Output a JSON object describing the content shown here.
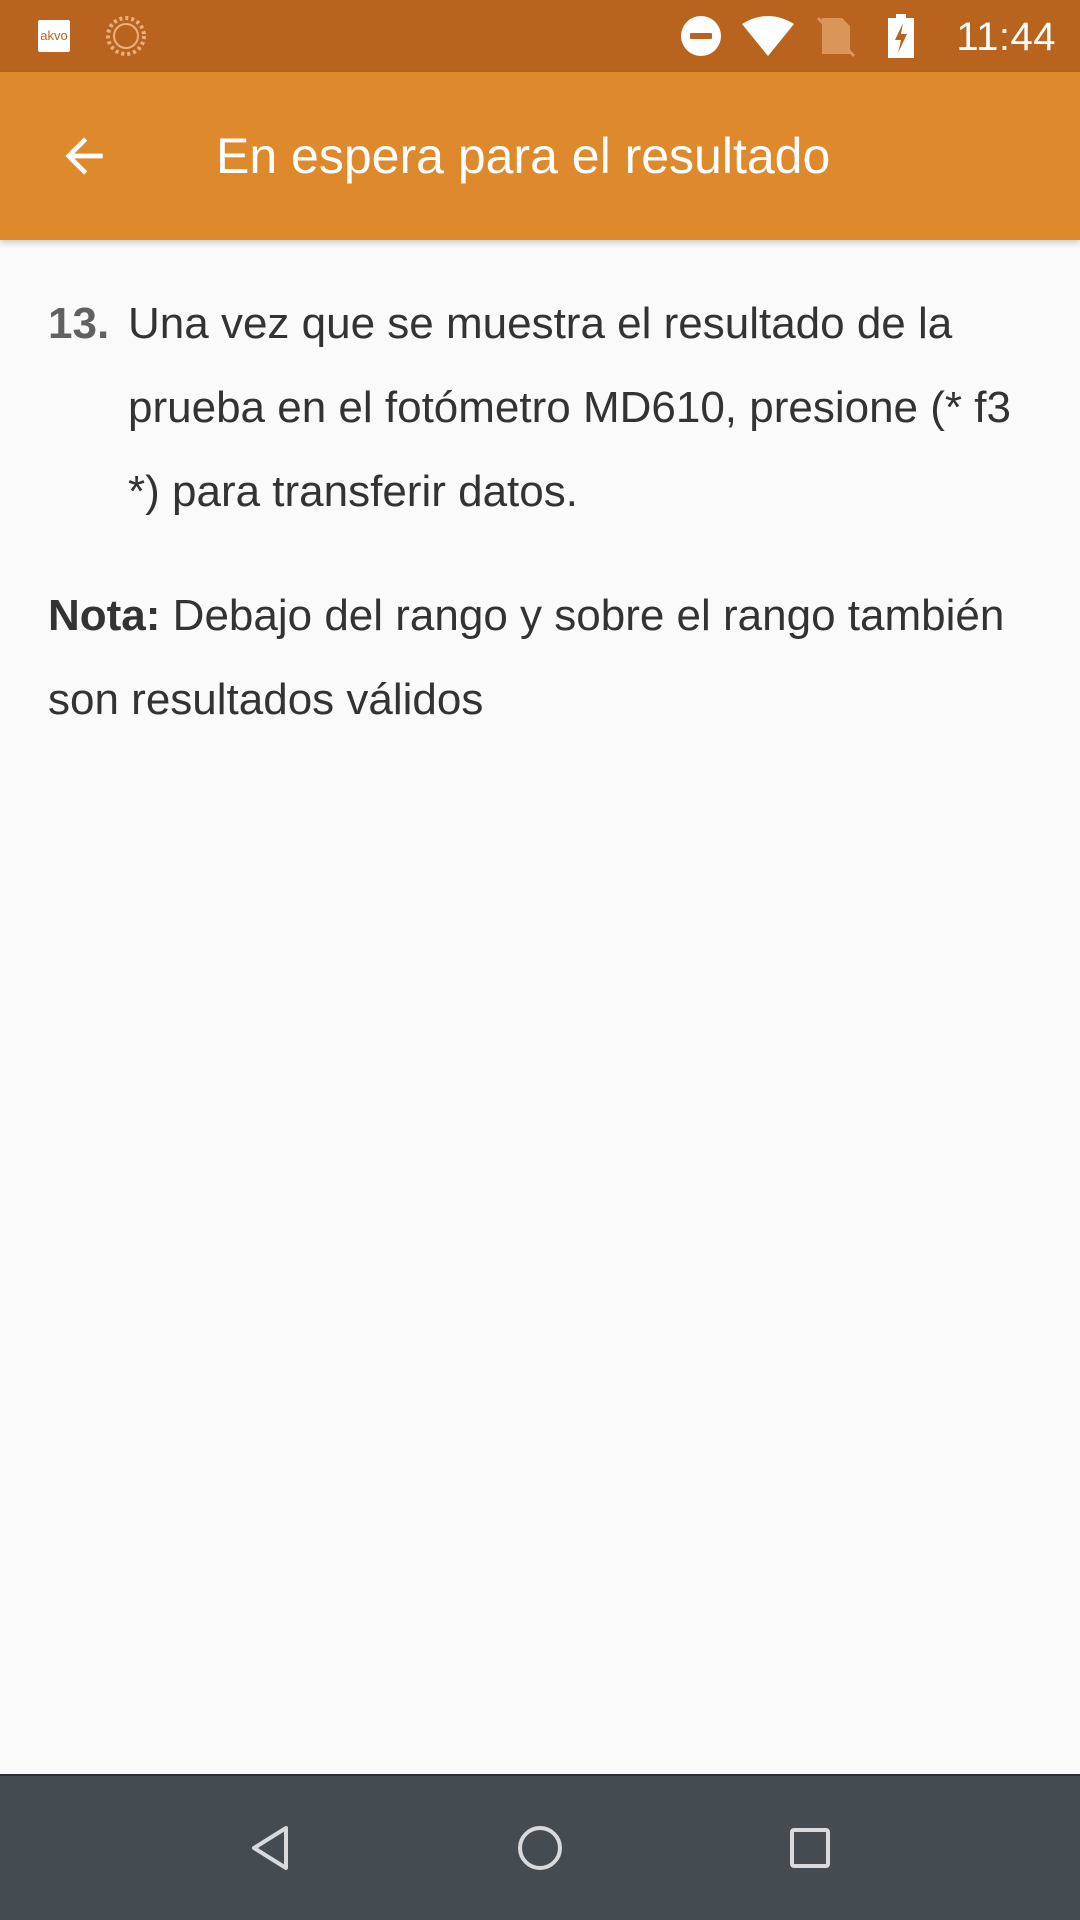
{
  "status_bar": {
    "notification_app_label": "akvo",
    "time": "11:44",
    "icons": [
      "akvo-notification-icon",
      "sync-spinner-icon",
      "do-not-disturb-icon",
      "wifi-icon",
      "no-sim-icon",
      "battery-charging-icon"
    ]
  },
  "app_bar": {
    "title": "En espera para el resultado",
    "back_icon": "arrow-back-icon"
  },
  "content": {
    "step_number": "13.",
    "step_text": "Una vez que se muestra el resultado de la prueba en el fotómetro MD610, presione (* f3 *) para transferir datos.",
    "note_label": "Nota:",
    "note_text": " Debajo del rango y sobre el rango también son resultados válidos"
  },
  "nav_bar": {
    "icons": [
      "nav-back-icon",
      "nav-home-icon",
      "nav-recents-icon"
    ]
  },
  "colors": {
    "status_bar": "#b8641e",
    "app_bar": "#de892c",
    "background": "#fafafa",
    "nav_bar": "#444b51"
  }
}
